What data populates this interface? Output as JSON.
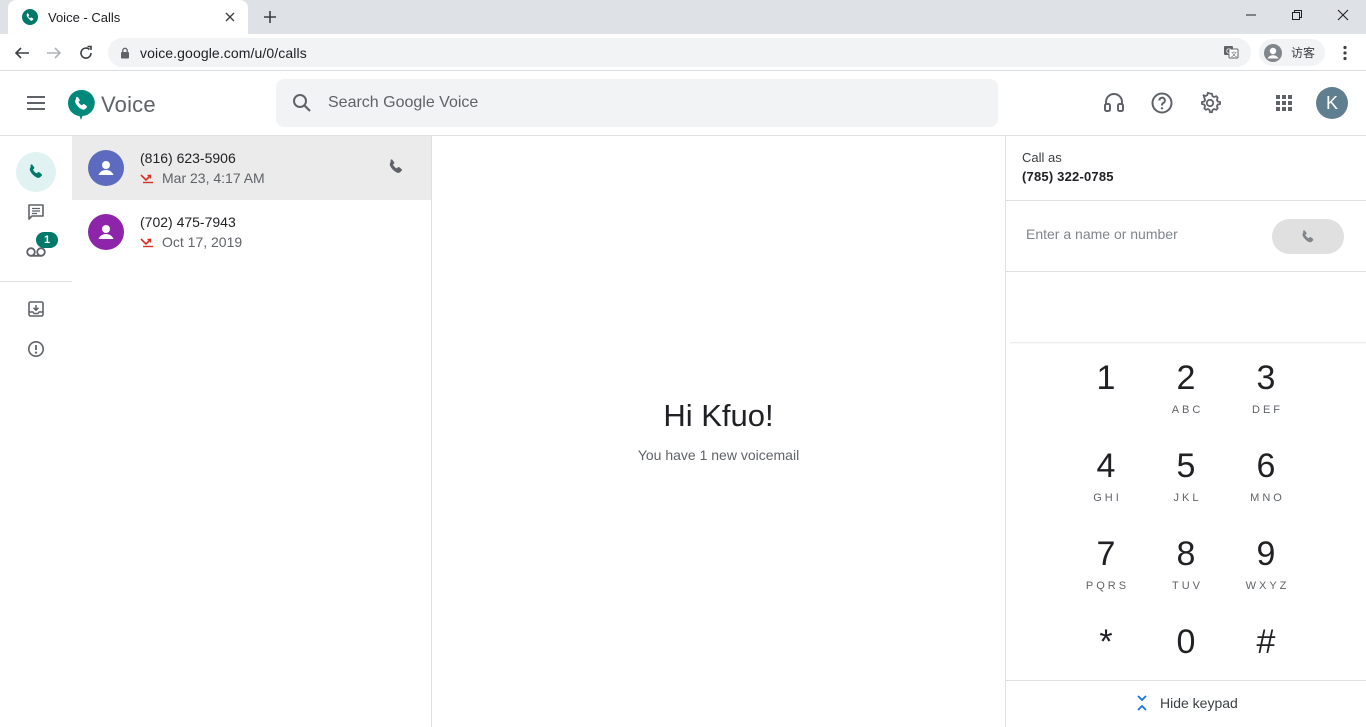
{
  "browser": {
    "tab_title": "Voice - Calls",
    "url": "voice.google.com/u/0/calls",
    "profile_label": "访客"
  },
  "app": {
    "name": "Voice",
    "search_placeholder": "Search Google Voice",
    "avatar_letter": "K",
    "brand_color": "#00796b"
  },
  "rail": {
    "voicemail_badge": "1"
  },
  "calls": [
    {
      "number": "(816) 623-5906",
      "date": "Mar 23, 4:17 AM",
      "avatar_color": "#5c6bc0",
      "status": "missed"
    },
    {
      "number": "(702) 475-7943",
      "date": "Oct 17, 2019",
      "avatar_color": "#8e24aa",
      "status": "missed"
    }
  ],
  "greeting": {
    "title": "Hi Kfuo!",
    "subtitle": "You have 1 new voicemail"
  },
  "dialer": {
    "call_as_label": "Call as",
    "call_as_number": "(785) 322-0785",
    "input_placeholder": "Enter a name or number",
    "keys": [
      {
        "digit": "1",
        "letters": ""
      },
      {
        "digit": "2",
        "letters": "ABC"
      },
      {
        "digit": "3",
        "letters": "DEF"
      },
      {
        "digit": "4",
        "letters": "GHI"
      },
      {
        "digit": "5",
        "letters": "JKL"
      },
      {
        "digit": "6",
        "letters": "MNO"
      },
      {
        "digit": "7",
        "letters": "PQRS"
      },
      {
        "digit": "8",
        "letters": "TUV"
      },
      {
        "digit": "9",
        "letters": "WXYZ"
      },
      {
        "digit": "*",
        "letters": ""
      },
      {
        "digit": "0",
        "letters": ""
      },
      {
        "digit": "#",
        "letters": ""
      }
    ],
    "hide_keypad_label": "Hide keypad"
  }
}
